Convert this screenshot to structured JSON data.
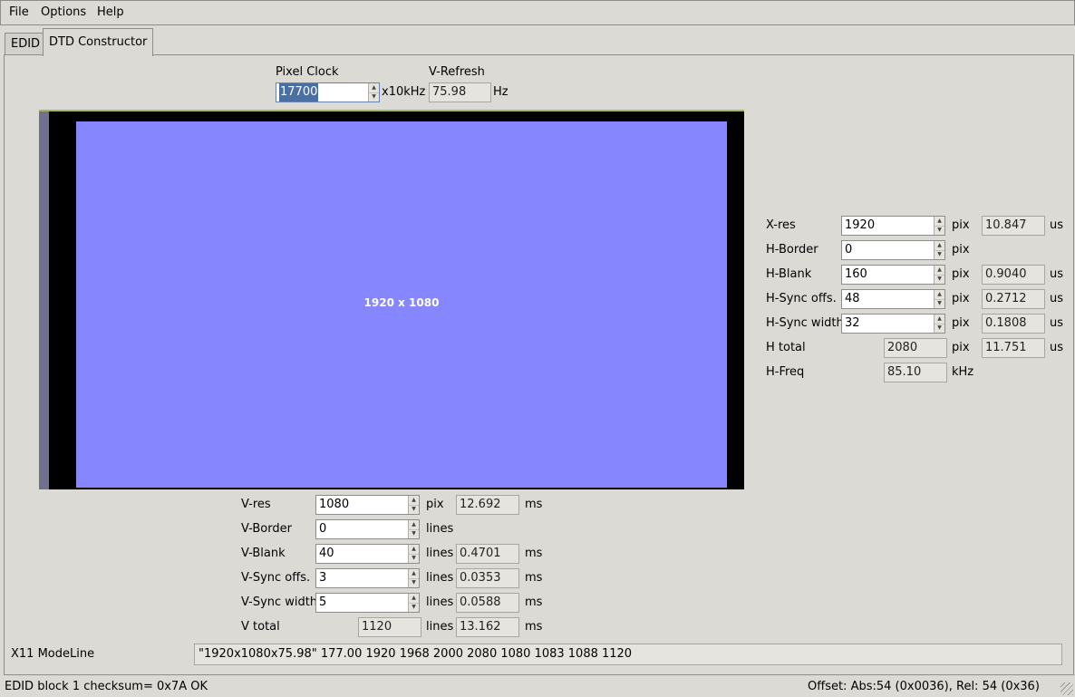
{
  "menu": {
    "file": "File",
    "options": "Options",
    "help": "Help"
  },
  "tabs": {
    "edid": "EDID",
    "dtd": "DTD Constructor"
  },
  "pixel_clock": {
    "label": "Pixel Clock",
    "value": "17700",
    "unit": "x10kHz"
  },
  "v_refresh": {
    "label": "V-Refresh",
    "value": "75.98",
    "unit": "Hz"
  },
  "preview": {
    "caption": "1920 x 1080",
    "colors": {
      "frame": "#000000",
      "active": "#8686ff",
      "left_bar": "#71718f"
    }
  },
  "horizontal": {
    "xres": {
      "label": "X-res",
      "value": "1920",
      "unit": "pix",
      "time": "10.847",
      "time_unit": "us"
    },
    "hborder": {
      "label": "H-Border",
      "value": "0",
      "unit": "pix"
    },
    "hblank": {
      "label": "H-Blank",
      "value": "160",
      "unit": "pix",
      "time": "0.9040",
      "time_unit": "us"
    },
    "hsync_offs": {
      "label": "H-Sync offs.",
      "value": "48",
      "unit": "pix",
      "time": "0.2712",
      "time_unit": "us"
    },
    "hsync_width": {
      "label": "H-Sync width",
      "value": "32",
      "unit": "pix",
      "time": "0.1808",
      "time_unit": "us"
    },
    "htotal": {
      "label": "H total",
      "value": "2080",
      "unit": "pix",
      "time": "11.751",
      "time_unit": "us"
    },
    "hfreq": {
      "label": "H-Freq",
      "value": "85.10",
      "unit": "kHz"
    }
  },
  "vertical": {
    "vres": {
      "label": "V-res",
      "value": "1080",
      "unit": "pix",
      "time": "12.692",
      "time_unit": "ms"
    },
    "vborder": {
      "label": "V-Border",
      "value": "0",
      "unit": "lines"
    },
    "vblank": {
      "label": "V-Blank",
      "value": "40",
      "unit": "lines",
      "time": "0.4701",
      "time_unit": "ms"
    },
    "vsync_offs": {
      "label": "V-Sync offs.",
      "value": "3",
      "unit": "lines",
      "time": "0.0353",
      "time_unit": "ms"
    },
    "vsync_width": {
      "label": "V-Sync width",
      "value": "5",
      "unit": "lines",
      "time": "0.0588",
      "time_unit": "ms"
    },
    "vtotal": {
      "label": "V total",
      "value": "1120",
      "unit": "lines",
      "time": "13.162",
      "time_unit": "ms"
    }
  },
  "modeline": {
    "label": "X11 ModeLine",
    "value": "\"1920x1080x75.98\" 177.00 1920 1968 2000 2080 1080 1083 1088 1120"
  },
  "status": {
    "left": "EDID block 1 checksum= 0x7A OK",
    "right": "Offset: Abs:54 (0x0036), Rel: 54 (0x36)"
  }
}
